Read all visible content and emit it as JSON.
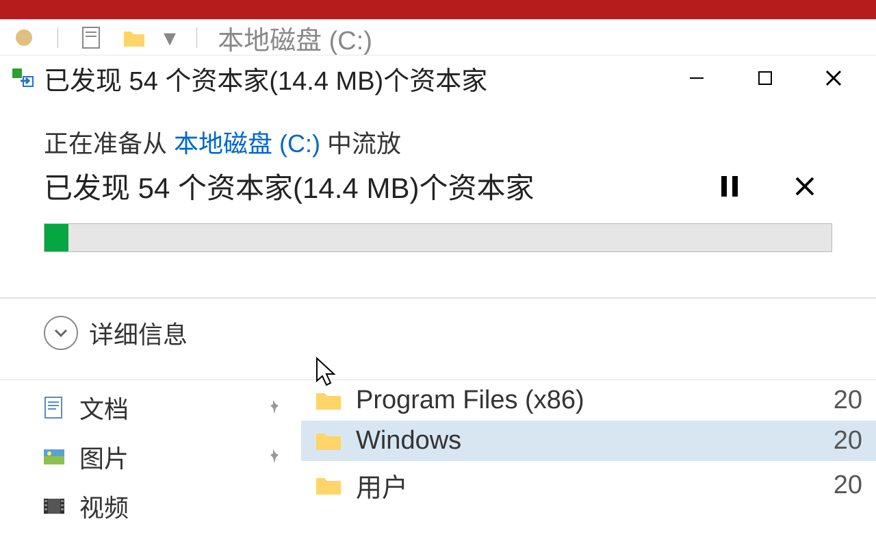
{
  "explorer_title": "本地磁盘 (C:)",
  "dialog": {
    "title": "已发现 54 个资本家(14.4 MB)个资本家",
    "prepare_prefix": "正在准备从 ",
    "prepare_link": "本地磁盘 (C:)",
    "prepare_suffix": " 中流放",
    "found_text": "已发现 54 个资本家(14.4 MB)个资本家",
    "progress_percent": 3,
    "details_label": "详细信息"
  },
  "sidebar": {
    "items": [
      {
        "label": "文档",
        "icon": "doc",
        "pinned": true
      },
      {
        "label": "图片",
        "icon": "pic",
        "pinned": true
      },
      {
        "label": "视频",
        "icon": "vid",
        "pinned": false
      }
    ]
  },
  "files": [
    {
      "name": "Program Files (x86)",
      "date": "20",
      "selected": false
    },
    {
      "name": "Windows",
      "date": "20",
      "selected": true
    },
    {
      "name": "用户",
      "date": "20",
      "selected": false
    }
  ]
}
